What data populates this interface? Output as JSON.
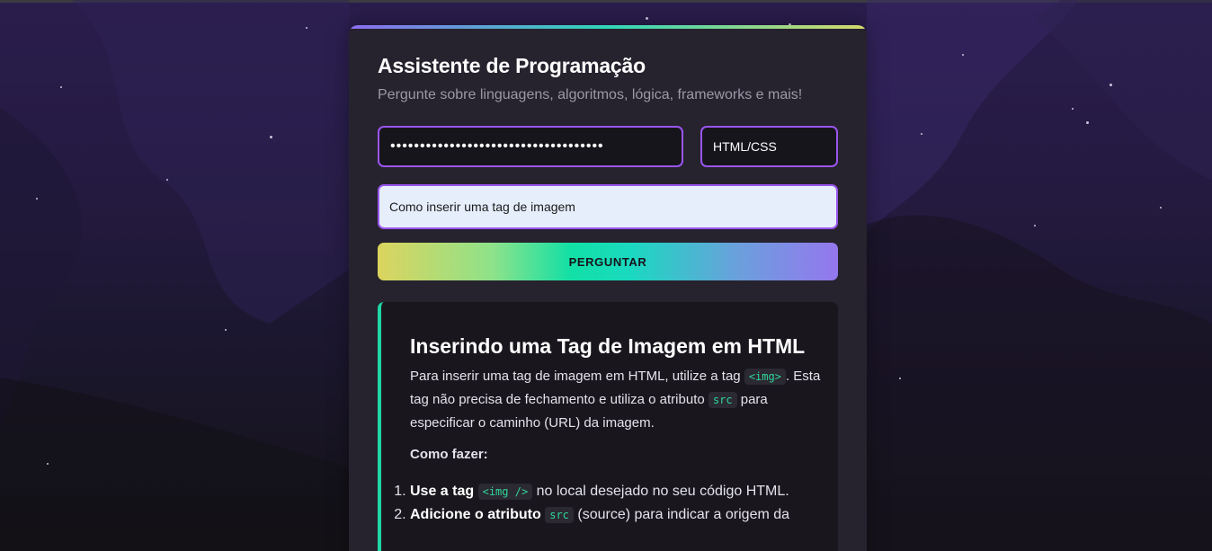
{
  "card": {
    "title": "Assistente de Programação",
    "subtitle": "Pergunte sobre linguagens, algoritmos, lógica, frameworks e mais!"
  },
  "form": {
    "api_key_masked": "••••••••••••••••••••••••••••••••••••",
    "language_value": "HTML/CSS",
    "question_value": "Como inserir uma tag de imagem",
    "ask_button_label": "PERGUNTAR"
  },
  "answer": {
    "title": "Inserindo uma Tag de Imagem em HTML",
    "intro_1": "Para inserir uma tag de imagem em HTML, utilize a tag",
    "code_img": "<img>",
    "intro_2": ". Esta tag não precisa de fechamento e utiliza o atributo",
    "code_src": "src",
    "intro_3": "para especificar o caminho (URL) da imagem.",
    "howto_label": "Como fazer:",
    "steps": [
      {
        "bold": "Use a tag",
        "code": "<img />",
        "text": "no local desejado no seu código HTML."
      },
      {
        "bold": "Adicione o atributo",
        "code": "src",
        "text": "(source) para indicar a origem da"
      }
    ]
  },
  "colors": {
    "accent_purple": "#9a55f0",
    "accent_teal": "#1fd6a4",
    "code_green": "#2fd69b"
  }
}
